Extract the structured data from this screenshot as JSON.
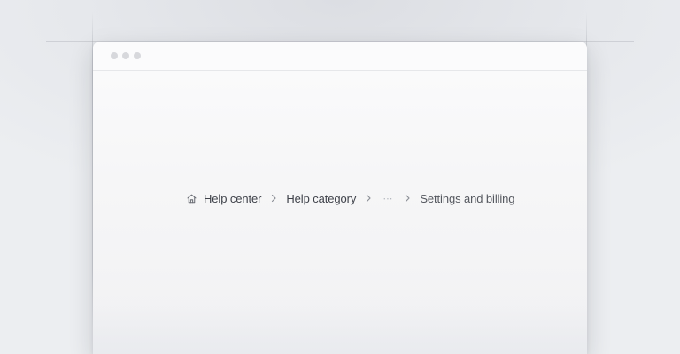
{
  "breadcrumb": {
    "home_icon": "home-icon",
    "separator_icon": "chevron-right-icon",
    "items": [
      {
        "label": "Help center"
      },
      {
        "label": "Help category"
      }
    ],
    "collapsed": "⋯",
    "current": "Settings and billing"
  },
  "colors": {
    "link_text": "#3f424a",
    "current_text": "#55585f",
    "muted": "#b3b6bd",
    "window_bg": "#f6f6f7",
    "titlebar_dot": "#d7d8dc"
  }
}
